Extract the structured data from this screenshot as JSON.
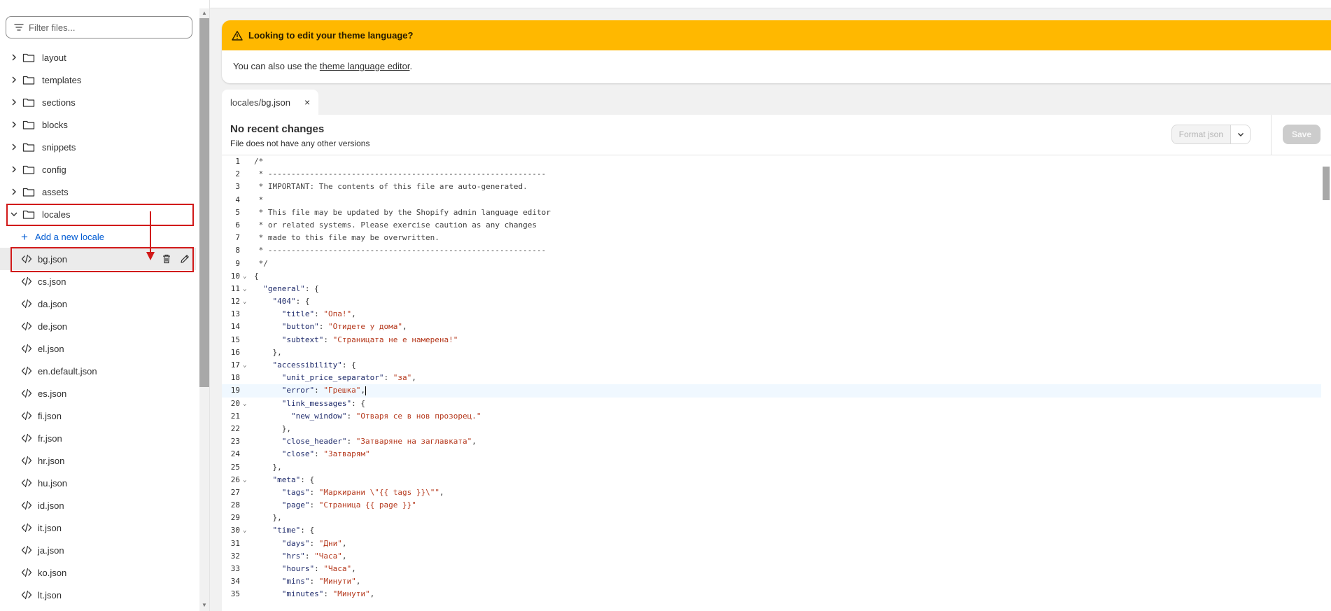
{
  "sidebar": {
    "filter_placeholder": "Filter files...",
    "folders": [
      {
        "label": "layout",
        "expanded": false
      },
      {
        "label": "templates",
        "expanded": false
      },
      {
        "label": "sections",
        "expanded": false
      },
      {
        "label": "blocks",
        "expanded": false
      },
      {
        "label": "snippets",
        "expanded": false
      },
      {
        "label": "config",
        "expanded": false
      },
      {
        "label": "assets",
        "expanded": false
      },
      {
        "label": "locales",
        "expanded": true
      }
    ],
    "add_locale_label": "Add a new locale",
    "files": [
      "bg.json",
      "cs.json",
      "da.json",
      "de.json",
      "el.json",
      "en.default.json",
      "es.json",
      "fi.json",
      "fr.json",
      "hr.json",
      "hu.json",
      "id.json",
      "it.json",
      "ja.json",
      "ko.json",
      "lt.json"
    ],
    "active_file": "bg.json"
  },
  "banner": {
    "title": "Looking to edit your theme language?",
    "body_prefix": "You can also use the ",
    "link_text": "theme language editor",
    "body_suffix": "."
  },
  "tab": {
    "dir": "locales/",
    "name": "bg.json",
    "close": "×"
  },
  "file_header": {
    "title": "No recent changes",
    "subtitle": "File does not have any other versions",
    "format_label": "Format json",
    "save_label": "Save"
  },
  "code_lines": [
    "/*",
    " * ------------------------------------------------------------",
    " * IMPORTANT: The contents of this file are auto-generated.",
    " *",
    " * This file may be updated by the Shopify admin language editor",
    " * or related systems. Please exercise caution as any changes",
    " * made to this file may be overwritten.",
    " * ------------------------------------------------------------",
    " */",
    "{",
    "  \"general\": {",
    "    \"404\": {",
    "      \"title\": \"Опа!\",",
    "      \"button\": \"Отидете у дома\",",
    "      \"subtext\": \"Страницата не е намерена!\"",
    "    },",
    "    \"accessibility\": {",
    "      \"unit_price_separator\": \"за\",",
    "      \"error\": \"Грешка\",",
    "      \"link_messages\": {",
    "        \"new_window\": \"Отваря се в нов прозорец.\"",
    "      },",
    "      \"close_header\": \"Затваряне на заглавката\",",
    "      \"close\": \"Затварям\"",
    "    },",
    "    \"meta\": {",
    "      \"tags\": \"Маркирани \\\"{{ tags }}\\\"\",",
    "      \"page\": \"Страница {{ page }}\"",
    "    },",
    "    \"time\": {",
    "      \"days\": \"Дни\",",
    "      \"hrs\": \"Часа\",",
    "      \"hours\": \"Часа\",",
    "      \"mins\": \"Минути\",",
    "      \"minutes\": \"Минути\","
  ],
  "fold_lines": [
    10,
    11,
    12,
    17,
    20,
    26,
    30
  ],
  "cursor_line": 19
}
